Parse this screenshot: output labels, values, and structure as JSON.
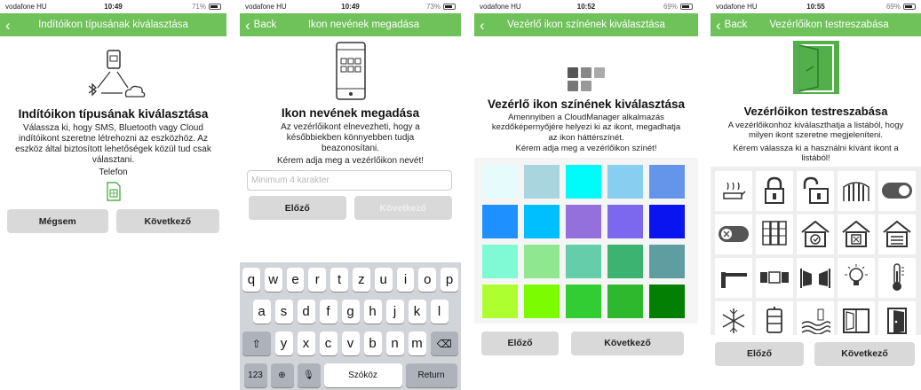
{
  "screens": [
    {
      "status": {
        "carrier": "vodafone HU",
        "time": "10:49",
        "battery": "71%"
      },
      "nav": {
        "back": "",
        "title": "Indítóikon típusának kiválasztása"
      },
      "heading": "Indítóikon típusának kiválasztása",
      "description": "Válassza ki, hogy SMS, Bluetooth vagy Cloud indítóikont szeretne létrehozni az eszközhöz. Az eszköz által biztosított lehetőségek közül tud csak választani.",
      "option_label": "Telefon",
      "buttons": {
        "cancel": "Mégsem",
        "next": "Következő"
      }
    },
    {
      "status": {
        "carrier": "vodafone HU",
        "time": "10:49",
        "battery": "73%"
      },
      "nav": {
        "back": "Back",
        "title": "Ikon nevének megadása"
      },
      "heading": "Ikon nevének megadása",
      "description": "Az vezérlőikont elnevezheti, hogy a későbbiekben könnyebben tudja beazonosítani.",
      "prompt": "Kérem adja meg a vezérlőikon nevét!",
      "input_placeholder": "Minimum 4 karakter",
      "buttons": {
        "prev": "Előző",
        "next": "Következő"
      },
      "keyboard": {
        "row1": [
          "q",
          "w",
          "e",
          "r",
          "t",
          "z",
          "u",
          "i",
          "o",
          "p"
        ],
        "row2": [
          "a",
          "s",
          "d",
          "f",
          "g",
          "h",
          "j",
          "k",
          "l"
        ],
        "row3": [
          "y",
          "x",
          "c",
          "v",
          "b",
          "n",
          "m"
        ],
        "numbers": "123",
        "space": "Szóköz",
        "return": "Return"
      }
    },
    {
      "status": {
        "carrier": "vodafone HU",
        "time": "10:52",
        "battery": "69%"
      },
      "nav": {
        "back": "",
        "title": "Vezérlő ikon színének kiválasztása"
      },
      "heading": "Vezérlő ikon színének kiválasztása",
      "description": "Amennyiben a CloudManager alkalmazás kezdőképernyőjére helyezi ki az ikont, megadhatja az ikon háttérszínét.",
      "prompt": "Kérem adja meg a vezérlőikon színét!",
      "colors": [
        "#e6fbfb",
        "#a9d5df",
        "#00fbfb",
        "#87cef0",
        "#6396ea",
        "#1e90ff",
        "#00bfff",
        "#9370db",
        "#7b68ee",
        "#0a14f0",
        "#7ffad4",
        "#8fe88f",
        "#66cdaa",
        "#3cb371",
        "#5f9ea0",
        "#adff2f",
        "#7cfc00",
        "#32cd32",
        "#2db82d",
        "#038003",
        "#fff8dc",
        "#fffacd",
        "#f5f5dc",
        "#ffe4c4",
        "#deb887"
      ],
      "buttons": {
        "prev": "Előző",
        "next": "Következő"
      }
    },
    {
      "status": {
        "carrier": "vodafone HU",
        "time": "10:55",
        "battery": "69%"
      },
      "nav": {
        "back": "Back",
        "title": "Vezérlőikon testreszabása"
      },
      "heading": "Vezérlőikon testreszabása",
      "description": "A vezérlőikonhoz kiválaszthatja a listából, hogy milyen ikont szeretne megjeleníteni.",
      "prompt": "Kérem válassza ki a használni kívánt ikont a listából!",
      "icons": [
        "heater-icon",
        "lock-closed-icon",
        "lock-open-icon",
        "fence-gate-icon",
        "toggle-on-icon",
        "toggle-off-icon",
        "server-rack-icon",
        "garage-closed-icon",
        "garage-open-icon",
        "garage-shutter-icon",
        "barrier-gate-icon",
        "sliding-gate-icon",
        "double-gate-icon",
        "light-bulb-icon",
        "thermometer-icon",
        "snowflake-icon",
        "radiator-icon",
        "floor-heating-icon",
        "window-icon",
        "door-icon"
      ],
      "buttons": {
        "prev": "Előző",
        "next": "Következő"
      }
    }
  ]
}
